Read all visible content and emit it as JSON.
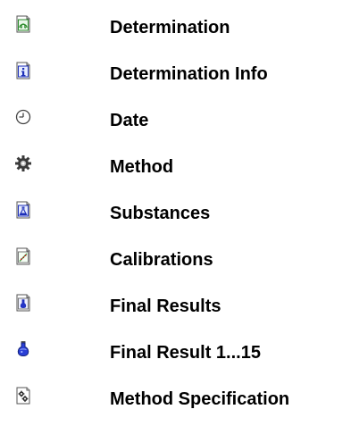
{
  "legend": {
    "items": [
      {
        "icon": "determination-icon",
        "label": "Determination"
      },
      {
        "icon": "determination-info-icon",
        "label": "Determination Info"
      },
      {
        "icon": "clock-icon",
        "label": "Date"
      },
      {
        "icon": "gear-icon",
        "label": "Method"
      },
      {
        "icon": "substances-icon",
        "label": "Substances"
      },
      {
        "icon": "calibration-chart-icon",
        "label": "Calibrations"
      },
      {
        "icon": "final-results-icon",
        "label": "Final Results"
      },
      {
        "icon": "flask-icon",
        "label": "Final Result 1...15"
      },
      {
        "icon": "method-specification-icon",
        "label": "Method Specification"
      }
    ]
  }
}
